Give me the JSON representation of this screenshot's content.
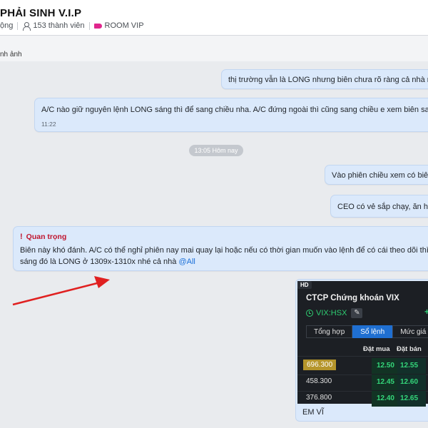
{
  "header": {
    "title": "PHẢI SINH V.I.P",
    "status_fragment": "ộng",
    "members": "153 thành viên",
    "room_tag": "ROOM VIP"
  },
  "subbar": {
    "text": "nh ảnh"
  },
  "messages": [
    {
      "text": "thị trường vẫn là LONG nhưng biên chưa rõ ràng cả nhà nhé, dễ"
    },
    {
      "text": "A/C nào giữ nguyên lệnh LONG sáng thì để sang chiều nha. A/C đứng ngoài thì cũng sang chiều e xem biên sao rồi vào lại",
      "time": "11:22"
    },
    {
      "text": "Vào phiên chiều xem có biên k"
    },
    {
      "text": "CEO có vẻ sắp chạy, ăn hết l"
    },
    {
      "label": "Quan trọng",
      "line1": "Biên này khó đánh. A/C có thể nghỉ phiên nay mai quay lại hoặc nếu có thời gian muốn vào lệnh để có cái theo dõi thì lại canh lệ",
      "line2": "sáng đó là LONG ở 1309x-1310x nhé cả nhà ",
      "mention": "@All"
    }
  ],
  "date_divider": "13:05 Hôm nay",
  "card": {
    "badge": "HD",
    "title": "CTCP Chứng khoán VIX",
    "ticker": "VIX:HSX",
    "tabs": [
      "Tổng hợp",
      "Sổ lệnh",
      "Mức giá"
    ],
    "active_tab": 1,
    "columns": {
      "bid": "Đặt mua",
      "ask": "Đặt bán"
    },
    "rows": [
      {
        "price": "696.300",
        "bid": "12.50",
        "ask": "12.55",
        "highlight": true
      },
      {
        "price": "458.300",
        "bid": "12.45",
        "ask": "12.60",
        "highlight": false
      },
      {
        "price": "376.800",
        "bid": "12.40",
        "ask": "12.65",
        "highlight": false
      }
    ],
    "caption": "EM VĨ"
  },
  "colors": {
    "bubble": "#dbe9fb",
    "important": "#c0152f",
    "mention": "#1a6fd8",
    "arrow": "#e02020",
    "room_tag": "#e0268d"
  },
  "icons": [
    "user-icon",
    "tag-icon",
    "exclamation-icon",
    "clock-icon",
    "edit-icon",
    "plus-icon",
    "arrow-annotation"
  ]
}
